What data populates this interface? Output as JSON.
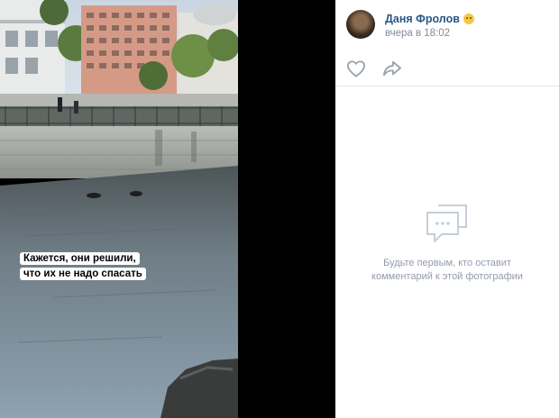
{
  "photo": {
    "caption_line1": "Кажется, они решили,",
    "caption_line2": "что их не надо спасать"
  },
  "post": {
    "author": "Даня Фролов",
    "author_emoji": "smiling-face-emoji",
    "time": "вчера в 18:02"
  },
  "actions": {
    "like_icon": "heart-icon",
    "share_icon": "share-arrow-icon"
  },
  "comments": {
    "empty_icon": "speech-bubble-icon",
    "empty_line1": "Будьте первым, кто оставит",
    "empty_line2": "комментарий к этой фотографии"
  },
  "colors": {
    "author_link": "#2a5885",
    "muted_text": "#818c99",
    "empty_text": "#939cab"
  }
}
